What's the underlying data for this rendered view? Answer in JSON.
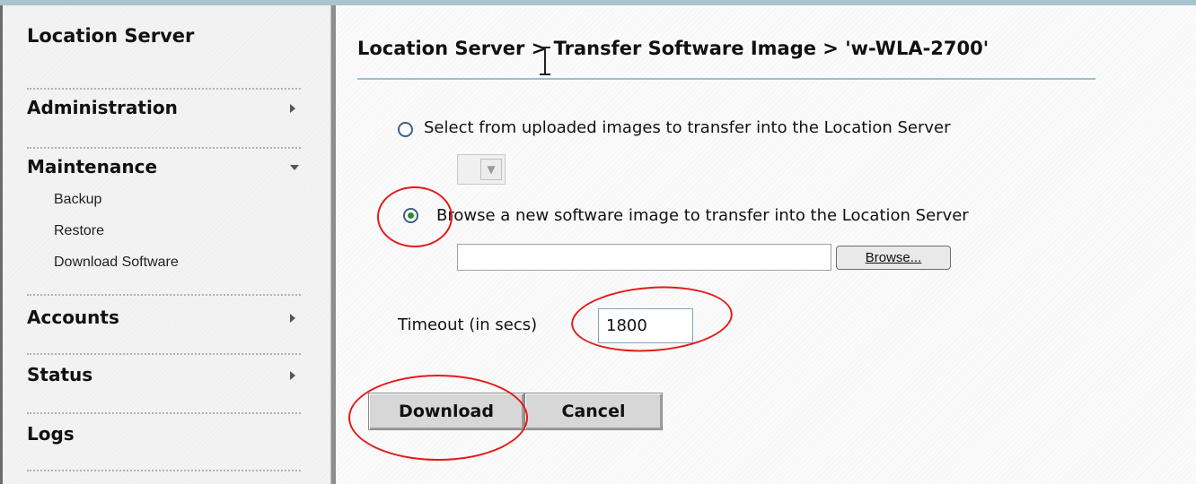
{
  "sidebar": {
    "title": "Location Server",
    "items": [
      {
        "label": "Administration",
        "arrow": "right"
      },
      {
        "label": "Maintenance",
        "arrow": "down",
        "children": [
          "Backup",
          "Restore",
          "Download Software"
        ]
      },
      {
        "label": "Accounts",
        "arrow": "right"
      },
      {
        "label": "Status",
        "arrow": "right"
      },
      {
        "label": "Logs"
      }
    ]
  },
  "main": {
    "breadcrumb": "Location Server > Transfer Software Image > 'w-WLA-2700'",
    "option_uploaded": {
      "label": "Select from uploaded images to transfer into the Location Server",
      "selected": false
    },
    "option_browse": {
      "label": "Browse a new software image to transfer into the Location Server",
      "selected": true
    },
    "file_input_value": "",
    "browse_label": "Browse...",
    "timeout": {
      "label": "Timeout (in secs)",
      "value": "1800"
    },
    "buttons": {
      "download": "Download",
      "cancel": "Cancel"
    }
  },
  "colors": {
    "highlight_circle": "#e41b1b",
    "rule": "#9fbccb",
    "radio_checked": "#2f8a2f"
  }
}
